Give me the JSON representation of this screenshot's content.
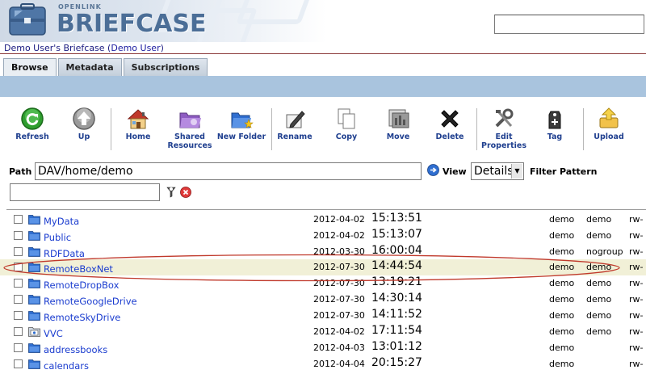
{
  "header": {
    "brand_small": "OPENLINK",
    "brand_big": "BRIEFCASE",
    "search_value": ""
  },
  "owner": {
    "prefix": "Demo User's Briefcase (",
    "user_link": "Demo User",
    "suffix": ")"
  },
  "tabs": [
    {
      "label": "Browse",
      "active": true
    },
    {
      "label": "Metadata",
      "active": false
    },
    {
      "label": "Subscriptions",
      "active": false
    }
  ],
  "toolbar": {
    "refresh": "Refresh",
    "up": "Up",
    "home": "Home",
    "shared_1": "Shared",
    "shared_2": "Resources",
    "new_folder": "New Folder",
    "rename": "Rename",
    "copy": "Copy",
    "move": "Move",
    "delete": "Delete",
    "edit_1": "Edit",
    "edit_2": "Properties",
    "tag": "Tag",
    "upload": "Upload"
  },
  "path": {
    "label": "Path",
    "value": "DAV/home/demo",
    "view_label": "View",
    "view_value": "Details",
    "filter_label": "Filter Pattern",
    "filter_value": ""
  },
  "files": [
    {
      "name": "MyData",
      "date": "2012-04-02",
      "time": "15:13:51",
      "owner": "demo",
      "group": "demo",
      "perm": "rw-",
      "icon": "folder-icon"
    },
    {
      "name": "Public",
      "date": "2012-04-02",
      "time": "15:13:07",
      "owner": "demo",
      "group": "demo",
      "perm": "rw-",
      "icon": "folder-icon"
    },
    {
      "name": "RDFData",
      "date": "2012-03-30",
      "time": "16:00:04",
      "owner": "demo",
      "group": "nogroup",
      "perm": "rw-",
      "icon": "folder-icon"
    },
    {
      "name": "RemoteBoxNet",
      "date": "2012-07-30",
      "time": "14:44:54",
      "owner": "demo",
      "group": "demo",
      "perm": "rw-",
      "icon": "folder-icon"
    },
    {
      "name": "RemoteDropBox",
      "date": "2012-07-30",
      "time": "13:19:21",
      "owner": "demo",
      "group": "demo",
      "perm": "rw-",
      "icon": "folder-icon"
    },
    {
      "name": "RemoteGoogleDrive",
      "date": "2012-07-30",
      "time": "14:30:14",
      "owner": "demo",
      "group": "demo",
      "perm": "rw-",
      "icon": "folder-icon"
    },
    {
      "name": "RemoteSkyDrive",
      "date": "2012-07-30",
      "time": "14:11:52",
      "owner": "demo",
      "group": "demo",
      "perm": "rw-",
      "icon": "folder-icon"
    },
    {
      "name": "VVC",
      "date": "2012-04-02",
      "time": "17:11:54",
      "owner": "demo",
      "group": "demo",
      "perm": "rw-",
      "icon": "special-folder-icon"
    },
    {
      "name": "addressbooks",
      "date": "2012-04-03",
      "time": "13:01:12",
      "owner": "demo",
      "group": "",
      "perm": "rw-",
      "icon": "folder-icon"
    },
    {
      "name": "calendars",
      "date": "2012-04-04",
      "time": "20:15:27",
      "owner": "demo",
      "group": "",
      "perm": "rw-",
      "icon": "folder-icon"
    }
  ],
  "colors": {
    "link": "#1a3ccf",
    "tab_band": "#a9c4de",
    "highlight_row": "#f1f0d7",
    "annotation": "#c0392b"
  }
}
